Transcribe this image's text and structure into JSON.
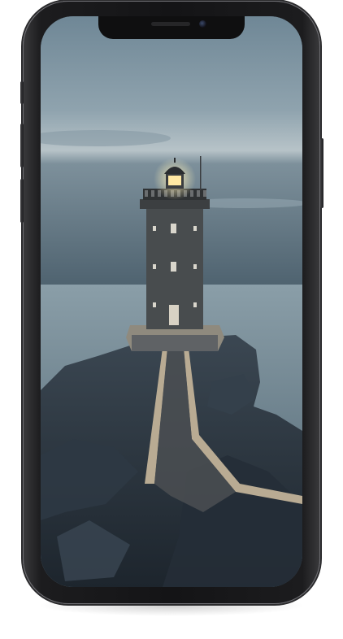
{
  "device": {
    "model": "smartphone",
    "wallpaper": "lighthouse-on-rocky-coast-at-dusk"
  },
  "colors": {
    "sky_top": "#6f8796",
    "sky_bottom": "#b9c4c9",
    "sea": "#5a6f7c",
    "rock": "#28313a",
    "tower": "#4a4d4f",
    "lamp": "#ffe8a3",
    "frame": "#1c1c1e"
  }
}
